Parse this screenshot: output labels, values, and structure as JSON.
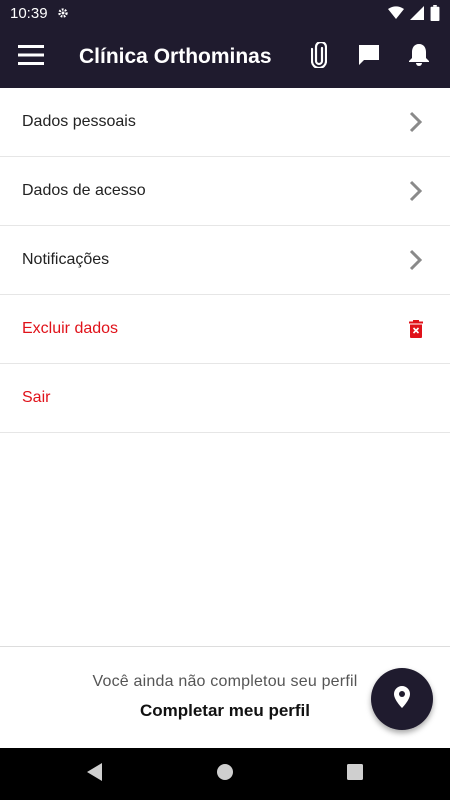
{
  "status_bar": {
    "time": "10:39"
  },
  "app_bar": {
    "title": "Clínica Orthominas",
    "icons": [
      "menu-icon",
      "paperclip-icon",
      "chat-icon",
      "bell-icon"
    ]
  },
  "menu": {
    "items": [
      {
        "label": "Dados pessoais",
        "trailing_icon": "chevron-right-icon",
        "style": "default"
      },
      {
        "label": "Dados de acesso",
        "trailing_icon": "chevron-right-icon",
        "style": "default"
      },
      {
        "label": "Notificações",
        "trailing_icon": "chevron-right-icon",
        "style": "default"
      },
      {
        "label": "Excluir dados",
        "trailing_icon": "trash-icon",
        "style": "danger"
      },
      {
        "label": "Sair",
        "trailing_icon": "",
        "style": "danger"
      }
    ]
  },
  "footer": {
    "message": "Você ainda não completou seu perfil",
    "cta_label": "Completar meu perfil"
  },
  "fab": {
    "icon": "location-pin-icon"
  },
  "colors": {
    "primary_dark": "#1f1b2e",
    "danger": "#e0121a",
    "chevron": "#8a8a8a"
  }
}
